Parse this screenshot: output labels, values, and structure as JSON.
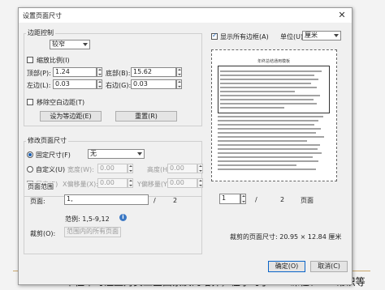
{
  "dialog": {
    "title": "设置页面尺寸",
    "close_glyph": "✕"
  },
  "margin_control": {
    "group_title": "边距控制",
    "preset": "较窄",
    "scale_label": "缩放比例(I)",
    "top_label": "顶部(P):",
    "top_value": "1.24",
    "bottom_label": "底部(B):",
    "bottom_value": "15.62",
    "left_label": "左边(L):",
    "left_value": "0.03",
    "right_label": "右边(G):",
    "right_value": "0.03",
    "remove_blank_label": "移除空白边距(T)",
    "equal_margins_button": "设为等边距(E)",
    "reset_button": "重置(R)"
  },
  "preview_options": {
    "show_all_margins_label": "显示所有边框(A)",
    "show_all_margins_checked": true,
    "unit_label": "单位(U):",
    "unit_value": "厘米"
  },
  "resize": {
    "group_title": "修改页面尺寸",
    "fixed_size_label": "固定尺寸(F)",
    "fixed_size_value": "无",
    "custom_label": "自定义(U)",
    "width_label": "宽度(W):",
    "width_value": "0.00",
    "height_label": "高度(H):",
    "height_value": "0.00",
    "center_label": "居中(E)",
    "x_offset_label": "X偏移量(X):",
    "x_offset_value": "0.00",
    "y_offset_label": "Y偏移量(Y):",
    "y_offset_value": "0.00"
  },
  "page_range": {
    "group_title": "页面范围",
    "page_label": "页面:",
    "page_value": "1,",
    "slash": "/",
    "total_pages": "2",
    "example": "范例: 1,5-9,12",
    "info_glyph": "i",
    "crop_label": "裁剪(O):",
    "crop_value": "范围内的所有页面"
  },
  "navigation": {
    "current_page": "1",
    "slash": "/",
    "total_pages": "2",
    "page_unit": "页面",
    "cropped_size": "裁剪的页面尺寸: 20.95 × 12.84 厘米"
  },
  "buttons": {
    "ok": "确定(O)",
    "cancel": "取消(C)"
  },
  "preview": {
    "heading": "年终总结通用模板"
  },
  "background": {
    "doc_text": "单位平时注重对员工全面素质的培养，在学习了 XX 课程、XX 常识等"
  }
}
